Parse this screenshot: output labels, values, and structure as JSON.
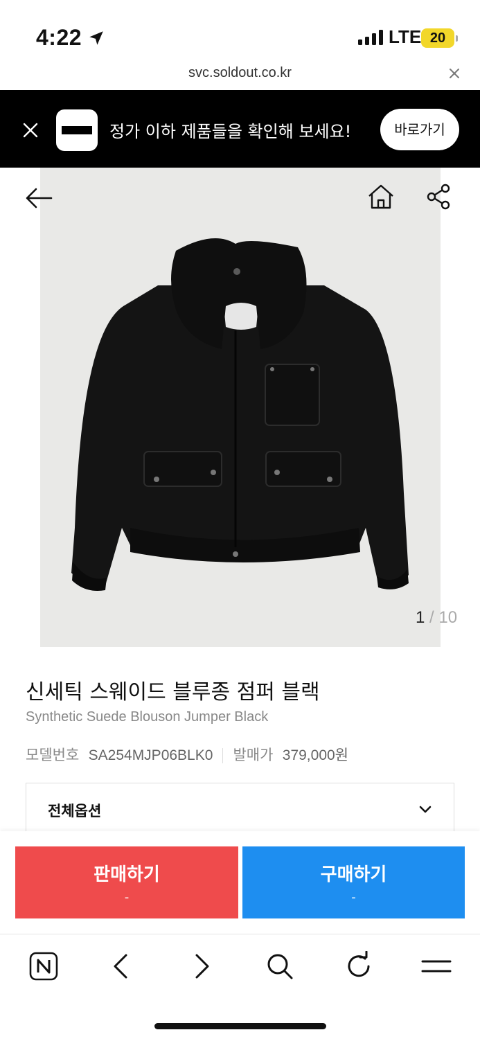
{
  "status_bar": {
    "time": "4:22",
    "network": "LTE",
    "battery": "20",
    "icons": [
      "location-arrow-icon",
      "signal-bars-icon"
    ]
  },
  "url_bar": {
    "url": "svc.soldout.co.kr",
    "close_icon": "close-icon"
  },
  "banner": {
    "text": "정가 이하 제품들을 확인해 보세요!",
    "button_label": "바로가기",
    "close_icon": "close-icon",
    "logo_icon": "soldout-logo-icon"
  },
  "gallery": {
    "current": "1",
    "separator": " / ",
    "total": "10",
    "icons": [
      "back-arrow-icon",
      "home-icon",
      "share-icon"
    ]
  },
  "product": {
    "name_kr": "신세틱 스웨이드 블루종 점퍼 블랙",
    "name_en": "Synthetic Suede Blouson Jumper Black",
    "model_label": "모델번호",
    "model_value": "SA254MJP06BLK0",
    "price_label": "발매가",
    "price_value": "379,000원"
  },
  "options": {
    "label": "전체옵션",
    "chevron_icon": "chevron-down-icon"
  },
  "actions": {
    "sell_label": "판매하기",
    "sell_sub": "-",
    "buy_label": "구매하기",
    "buy_sub": "-"
  },
  "toolbar": {
    "icons": [
      "naver-n-icon",
      "chevron-left-icon",
      "chevron-right-icon",
      "search-icon",
      "refresh-icon",
      "menu-icon"
    ]
  },
  "colors": {
    "sell": "#ef4b4c",
    "buy": "#1e8ef0",
    "banner_bg": "#000000",
    "battery": "#f2d72a"
  }
}
